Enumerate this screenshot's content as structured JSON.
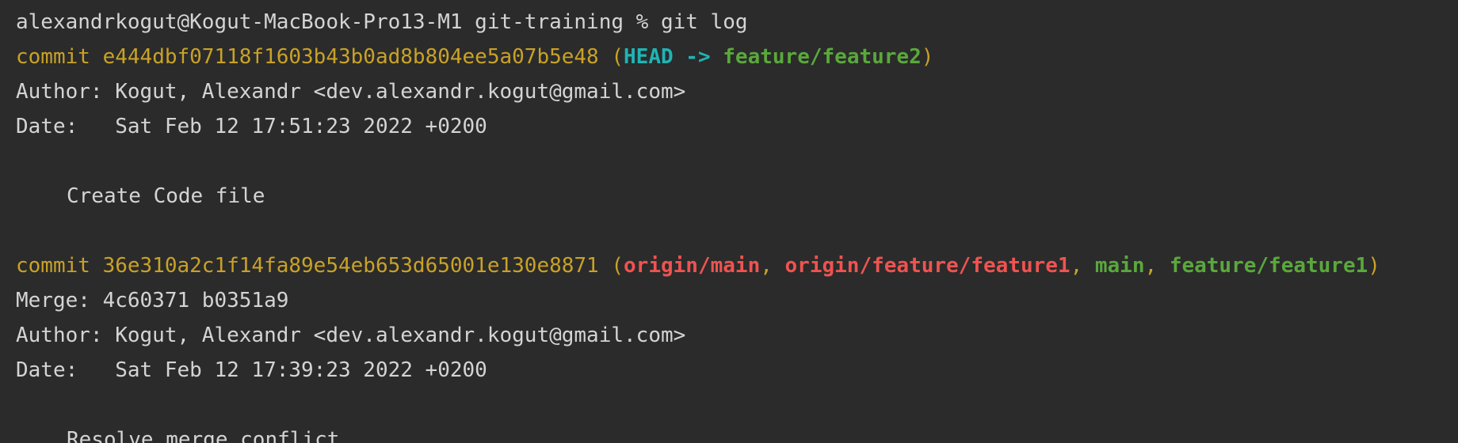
{
  "terminal": {
    "prompt": "alexandrkogut@Kogut-MacBook-Pro13-M1 git-training % git log",
    "commits": [
      {
        "commit_label": "commit",
        "hash": "e444dbf07118f1603b43b0ad8b804ee5a07b5e48",
        "open_paren": "(",
        "head_label": "HEAD",
        "arrow": " -> ",
        "branch": "feature/feature2",
        "close_paren": ")",
        "author": "Author: Kogut, Alexandr <dev.alexandr.kogut@gmail.com>",
        "date": "Date:   Sat Feb 12 17:51:23 2022 +0200",
        "message": "Create Code file"
      },
      {
        "commit_label": "commit",
        "hash": "36e310a2c1f14fa89e54eb653d65001e130e8871",
        "open_paren": "(",
        "ref1": "origin/main",
        "sep": ", ",
        "ref2": "origin/feature/feature1",
        "ref3": "main",
        "ref4": "feature/feature1",
        "close_paren": ")",
        "merge": "Merge: 4c60371 b0351a9",
        "author": "Author: Kogut, Alexandr <dev.alexandr.kogut@gmail.com>",
        "date": "Date:   Sat Feb 12 17:39:23 2022 +0200",
        "message": "Resolve merge conflict"
      }
    ]
  },
  "colors": {
    "background": "#2b2b2b",
    "text": "#d4d4d4",
    "commit_hash": "#c9a227",
    "head": "#1fb5b5",
    "local_branch": "#5aa83c",
    "remote_branch": "#ef5350"
  }
}
